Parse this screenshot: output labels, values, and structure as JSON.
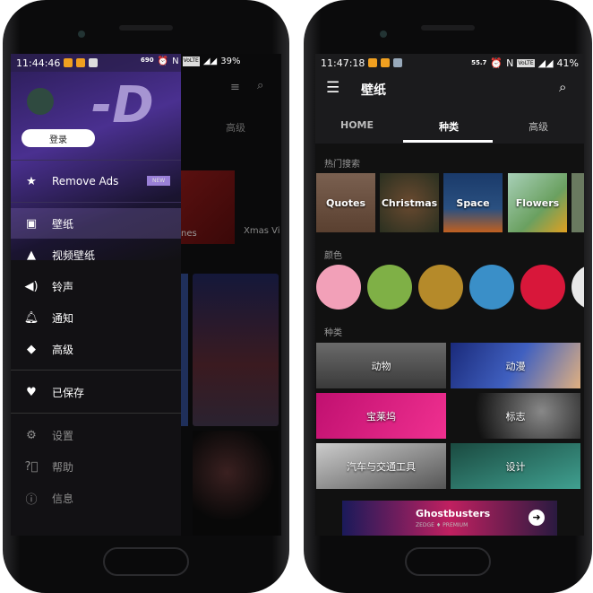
{
  "left_phone": {
    "status": {
      "time": "11:44:46",
      "speed": "690",
      "speed_unit": "KB/S",
      "battery": "39%",
      "volte": "VoLTE",
      "nfc": "N"
    },
    "drawer": {
      "login_label": "登录",
      "remove_ads": "Remove Ads",
      "new_badge": "NEW",
      "items": [
        {
          "label": "壁纸",
          "icon": "image-icon"
        },
        {
          "label": "视频壁纸",
          "icon": "video-wallpaper-icon"
        },
        {
          "label": "铃声",
          "icon": "speaker-icon"
        },
        {
          "label": "通知",
          "icon": "bell-icon"
        },
        {
          "label": "高级",
          "icon": "diamond-icon"
        }
      ],
      "saved": "已保存",
      "secondary": [
        {
          "label": "设置",
          "icon": "gear-icon"
        },
        {
          "label": "帮助",
          "icon": "help-icon"
        },
        {
          "label": "信息",
          "icon": "info-icon"
        }
      ]
    },
    "background": {
      "tab_premium": "高级",
      "card_label_1": "nes",
      "card_label_2": "Xmas Vi"
    }
  },
  "right_phone": {
    "status": {
      "time": "11:47:18",
      "speed": "55.7",
      "speed_unit": "KB/S",
      "battery": "41%",
      "volte": "VoLTE",
      "nfc": "N"
    },
    "toolbar": {
      "title": "壁纸"
    },
    "tabs": [
      {
        "label": "HOME"
      },
      {
        "label": "种类",
        "active": true
      },
      {
        "label": "高级"
      }
    ],
    "hot_search": {
      "title": "热门搜索",
      "tiles": [
        "Quotes",
        "Christmas",
        "Space",
        "Flowers"
      ]
    },
    "colors": {
      "title": "颜色",
      "swatches": [
        "#f2a0b8",
        "#7fb046",
        "#b58a2a",
        "#3a8fc8",
        "#d8173a",
        "#e8e8e8"
      ]
    },
    "categories": {
      "title": "种类",
      "items": [
        "动物",
        "动漫",
        "宝莱坞",
        "标志",
        "汽车与交通工具",
        "设计"
      ]
    },
    "banner": {
      "title": "Ghostbusters",
      "subtitle": "ZEDGE ♦ PREMIUM"
    }
  },
  "colors": {
    "drawer_accent": "#6a4fb0",
    "badge": "#9a80d8"
  }
}
